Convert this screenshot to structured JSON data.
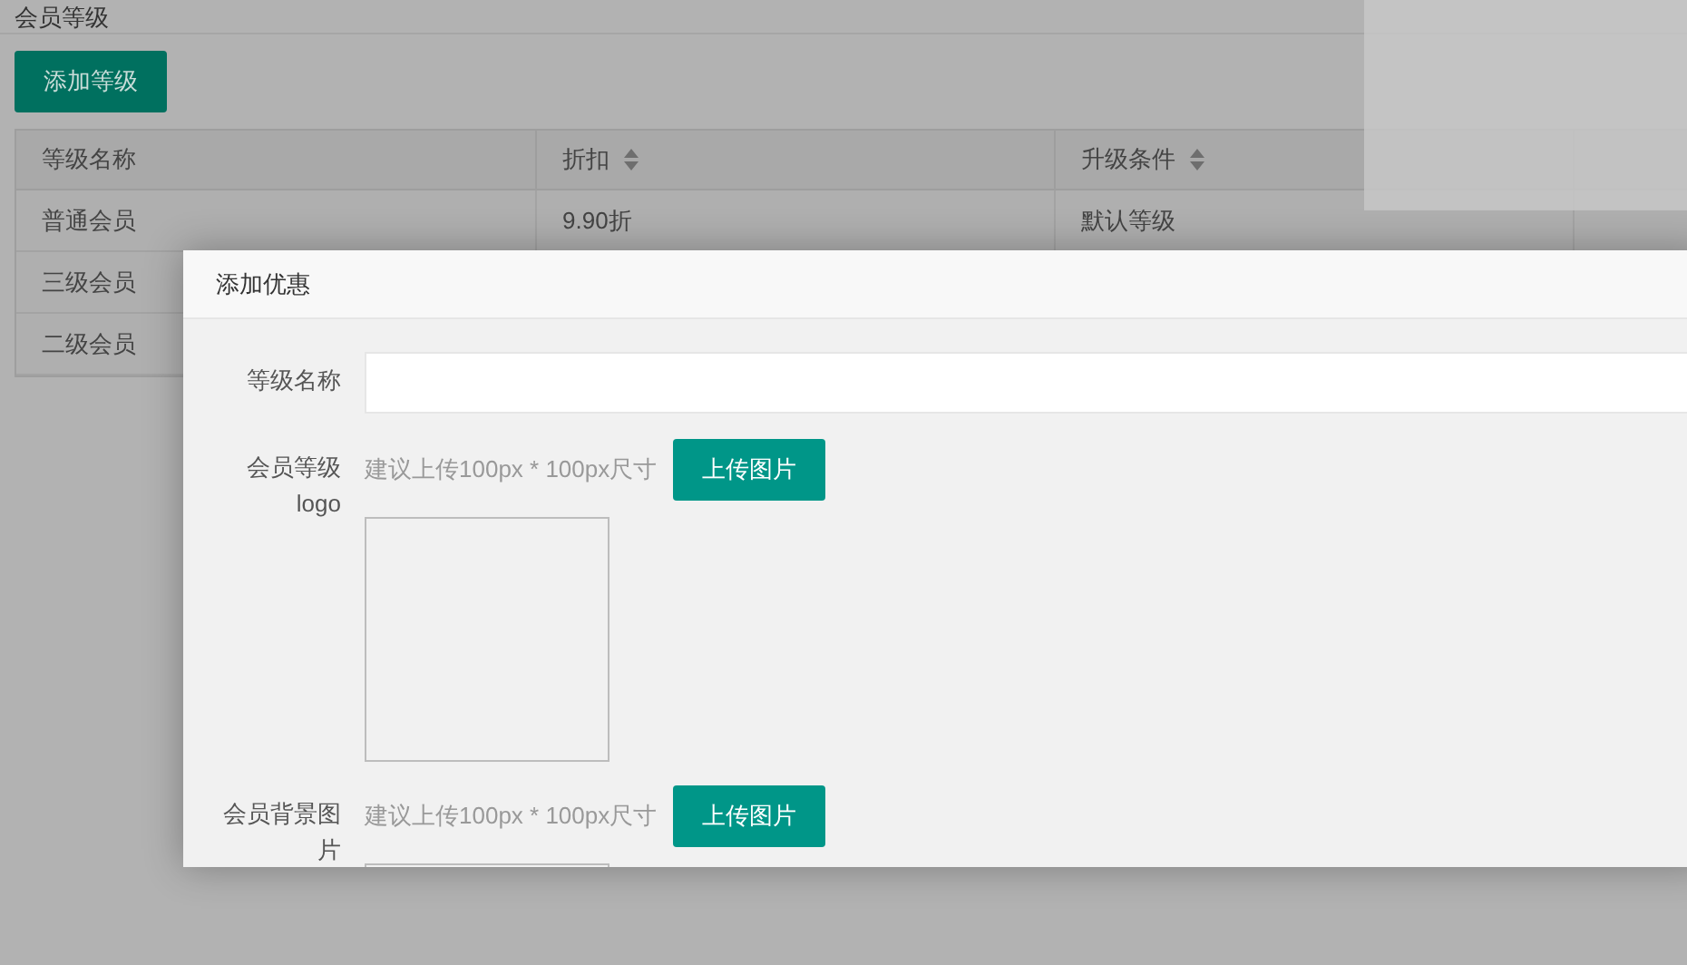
{
  "page": {
    "title": "会员等级"
  },
  "add_button": "添加等级",
  "table": {
    "columns": [
      {
        "label": "等级名称",
        "sortable": false
      },
      {
        "label": "折扣",
        "sortable": true
      },
      {
        "label": "升级条件",
        "sortable": true
      }
    ],
    "rows": [
      {
        "cells": [
          "普通会员",
          "9.90折",
          "默认等级"
        ]
      },
      {
        "cells": [
          "三级会员"
        ]
      },
      {
        "cells": [
          "二级会员"
        ]
      }
    ]
  },
  "modal": {
    "title": "添加优惠",
    "fields": [
      {
        "kind": "text",
        "label": "等级名称"
      },
      {
        "kind": "image",
        "label": "会员等级logo",
        "hint": "建议上传100px * 100px尺寸",
        "button": "上传图片"
      },
      {
        "kind": "image",
        "label": "会员背景图片",
        "hint": "建议上传100px * 100px尺寸",
        "button": "上传图片"
      }
    ]
  }
}
